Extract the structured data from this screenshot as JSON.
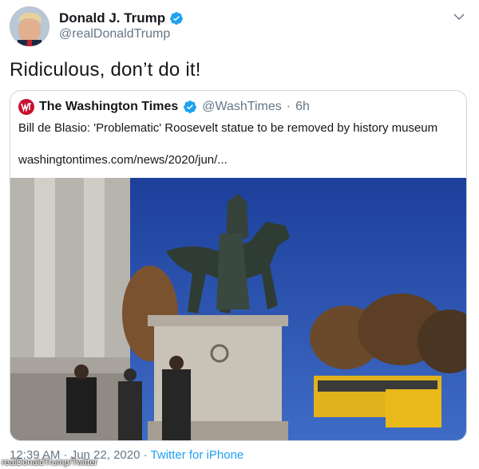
{
  "tweet": {
    "display_name": "Donald J. Trump",
    "handle": "@realDonaldTrump",
    "text": "Ridiculous, don’t do it!",
    "timestamp": "12:39 AM · Jun 22, 2020",
    "separator": "·",
    "source": "Twitter for iPhone"
  },
  "quoted": {
    "display_name": "The Washington Times",
    "handle": "@WashTimes",
    "separator": "·",
    "age": "6h",
    "text": "Bill de Blasio: 'Problematic' Roosevelt statue to be removed by history museum",
    "link": "washingtontimes.com/news/2020/jun/..."
  },
  "watermark": "realDonaldTrump/Twitter",
  "icons": {
    "verified": "verified-badge-icon",
    "more": "chevron-down-icon",
    "logo": "washington-times-logo-icon"
  },
  "colors": {
    "verified": "#1da1f2",
    "link": "#1da1f2",
    "muted": "#657786",
    "border": "#ccd6dd",
    "wt_logo": "#c8102e"
  }
}
